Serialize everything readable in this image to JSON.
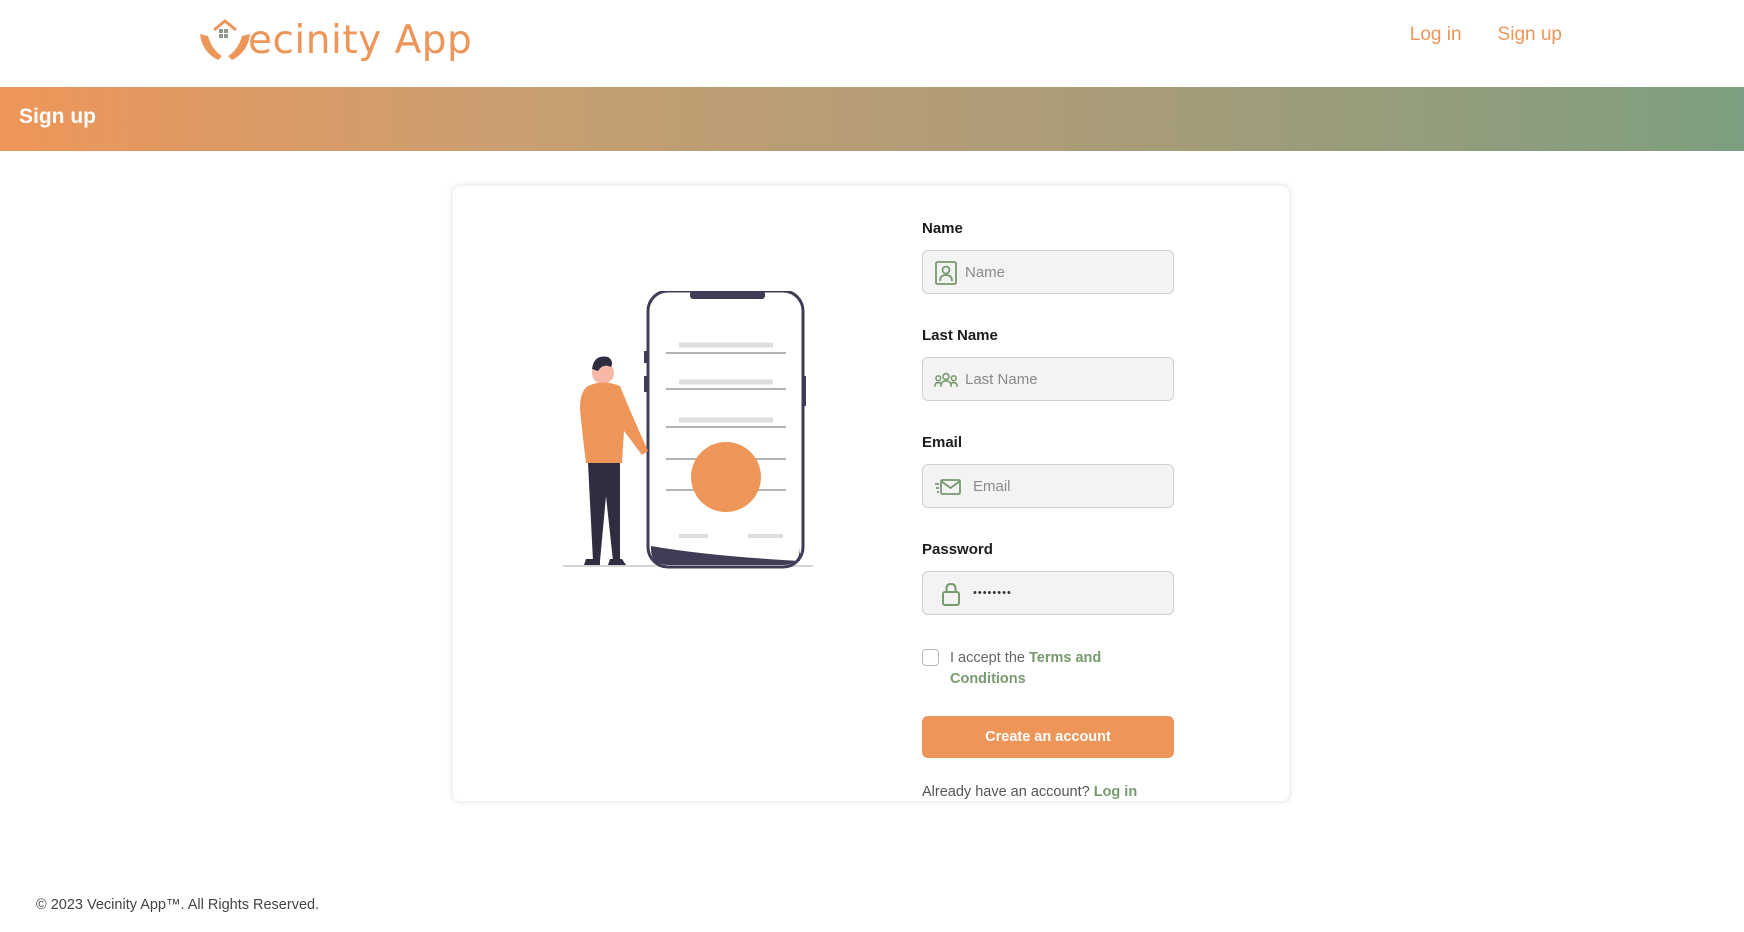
{
  "header": {
    "logo_text": "ecinity App",
    "nav": [
      {
        "label": "Log in"
      },
      {
        "label": "Sign up"
      }
    ]
  },
  "banner": {
    "title": "Sign up"
  },
  "form": {
    "name": {
      "label": "Name",
      "placeholder": "Name"
    },
    "last_name": {
      "label": "Last Name",
      "placeholder": "Last Name"
    },
    "email": {
      "label": "Email",
      "placeholder": "Email"
    },
    "password": {
      "label": "Password",
      "value": "••••••••"
    },
    "terms": {
      "prefix": "I accept the ",
      "link": "Terms and Conditions"
    },
    "submit_label": "Create an account",
    "already_text": "Already have an account? ",
    "login_link": "Log in"
  },
  "footer": {
    "text": "© 2023 Vecinity App™. All Rights Reserved."
  },
  "colors": {
    "accent": "#ee9659",
    "green": "#779a6e"
  }
}
